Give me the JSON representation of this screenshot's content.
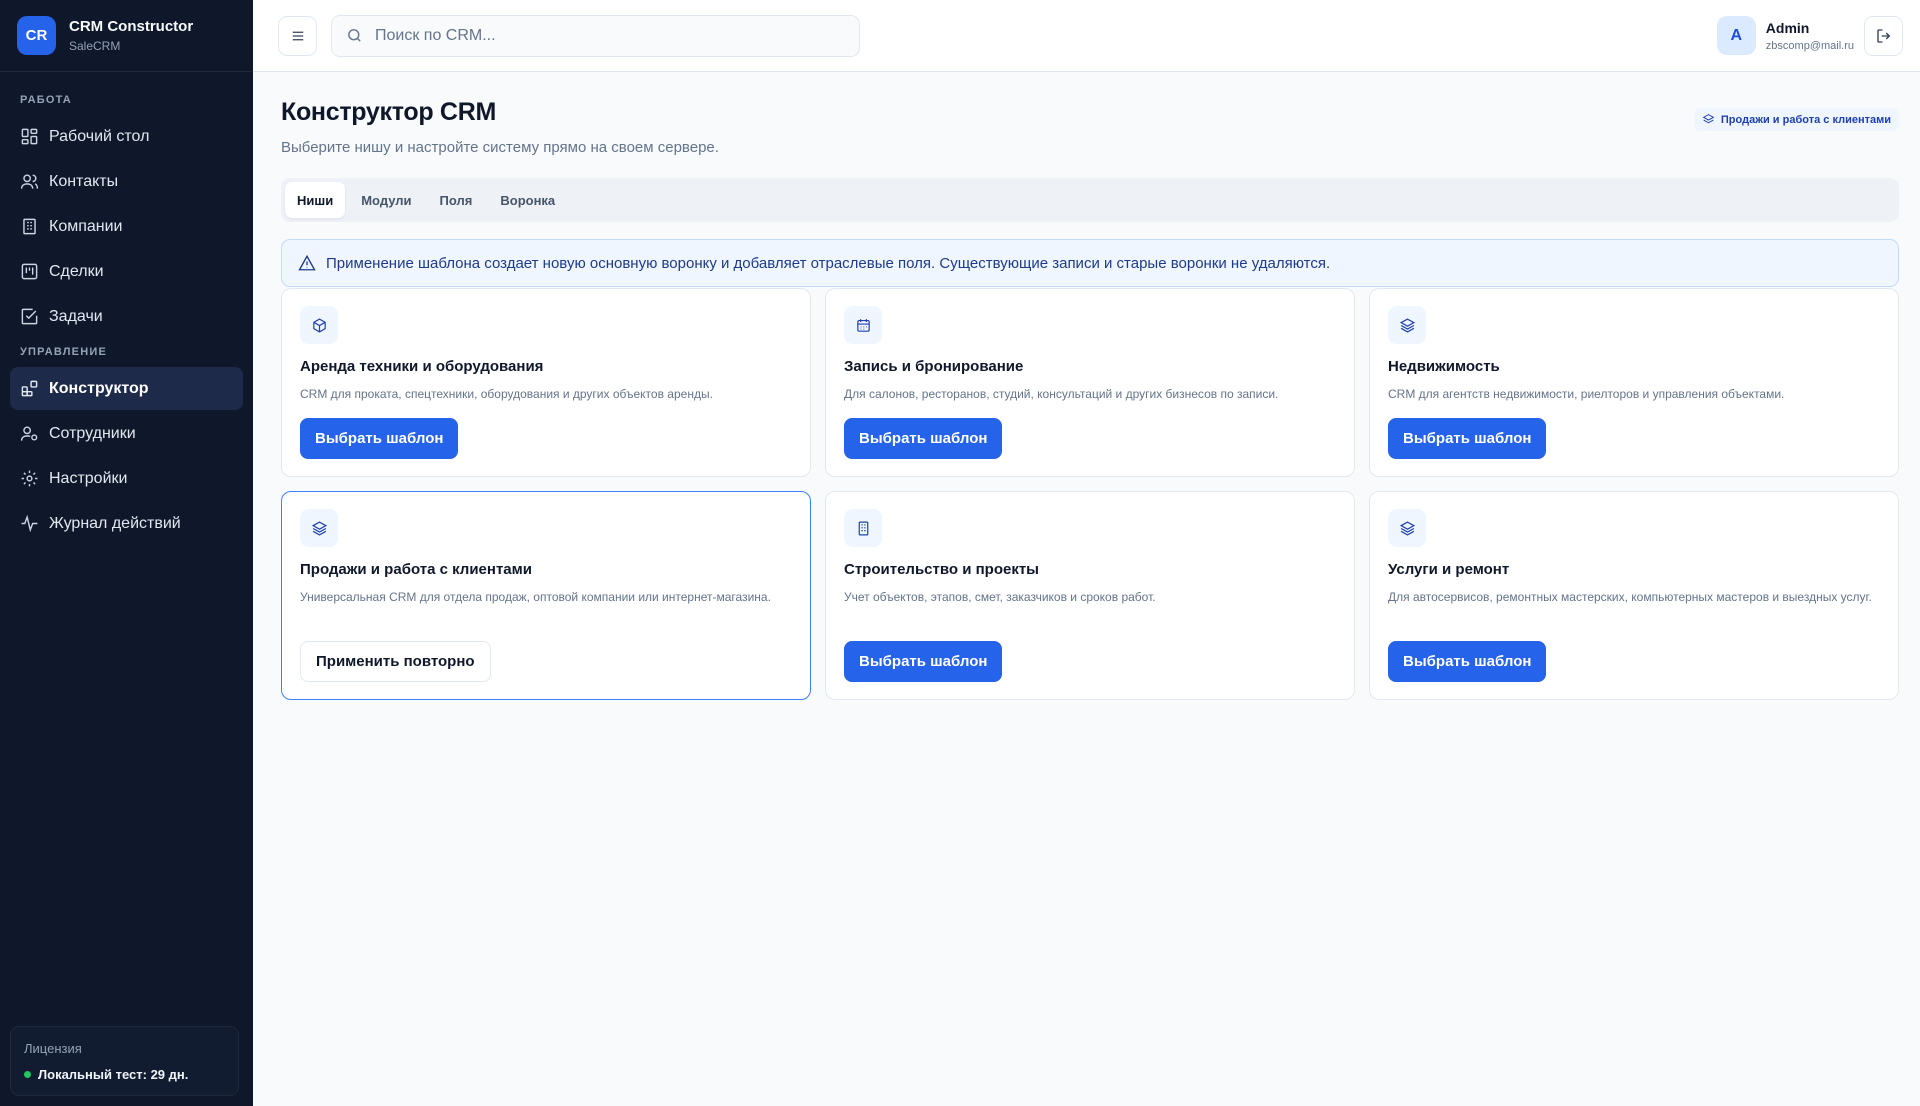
{
  "brand": {
    "logo": "CR",
    "title": "CRM Constructor",
    "subtitle": "SaleCRM"
  },
  "sidebar": {
    "section_work": "РАБОТА",
    "section_manage": "УПРАВЛЕНИЕ",
    "work_items": [
      {
        "label": "Рабочий стол",
        "icon": "dashboard-icon"
      },
      {
        "label": "Контакты",
        "icon": "users-icon"
      },
      {
        "label": "Компании",
        "icon": "building-icon"
      },
      {
        "label": "Сделки",
        "icon": "kanban-icon"
      },
      {
        "label": "Задачи",
        "icon": "checkbox-icon"
      }
    ],
    "manage_items": [
      {
        "label": "Конструктор",
        "icon": "blocks-icon",
        "active": true
      },
      {
        "label": "Сотрудники",
        "icon": "user-cog-icon"
      },
      {
        "label": "Настройки",
        "icon": "gear-icon"
      },
      {
        "label": "Журнал действий",
        "icon": "activity-icon"
      }
    ],
    "license": {
      "label": "Лицензия",
      "status": "Локальный тест: 29 дн.",
      "status_color": "#22c55e"
    }
  },
  "topbar": {
    "search_placeholder": "Поиск по CRM...",
    "user": {
      "initial": "A",
      "name": "Admin",
      "email": "zbscomp@mail.ru"
    }
  },
  "page": {
    "title": "Конструктор CRM",
    "subtitle": "Выберите нишу и настройте систему прямо на своем сервере.",
    "current_niche": "Продажи и работа с клиентами",
    "tabs": [
      "Ниши",
      "Модули",
      "Поля",
      "Воронка"
    ],
    "active_tab": "Ниши",
    "alert": "Применение шаблона создает новую основную воронку и добавляет отраслевые поля. Существующие записи и старые воронки не удаляются."
  },
  "cards": [
    {
      "title": "Аренда техники и оборудования",
      "description": "CRM для проката, спецтехники, оборудования и других объектов аренды.",
      "button": "Выбрать шаблон",
      "icon": "box-icon"
    },
    {
      "title": "Запись и бронирование",
      "description": "Для салонов, ресторанов, студий, консультаций и других бизнесов по записи.",
      "button": "Выбрать шаблон",
      "icon": "calendar-icon"
    },
    {
      "title": "Недвижимость",
      "description": "CRM для агентств недвижимости, риелторов и управления объектами.",
      "button": "Выбрать шаблон",
      "icon": "layers-icon"
    },
    {
      "title": "Продажи и работа с клиентами",
      "description": "Универсальная CRM для отдела продаж, оптовой компании или интернет-магазина.",
      "button": "Применить повторно",
      "icon": "layers-icon",
      "selected": true
    },
    {
      "title": "Строительство и проекты",
      "description": "Учет объектов, этапов, смет, заказчиков и сроков работ.",
      "button": "Выбрать шаблон",
      "icon": "building-icon"
    },
    {
      "title": "Услуги и ремонт",
      "description": "Для автосервисов, ремонтных мастерских, компьютерных мастеров и выездных услуг.",
      "button": "Выбрать шаблон",
      "icon": "layers-icon"
    }
  ],
  "colors": {
    "accent": "#2563eb",
    "sidebar_bg": "#0f172a",
    "alert_bg": "#eff6ff"
  }
}
